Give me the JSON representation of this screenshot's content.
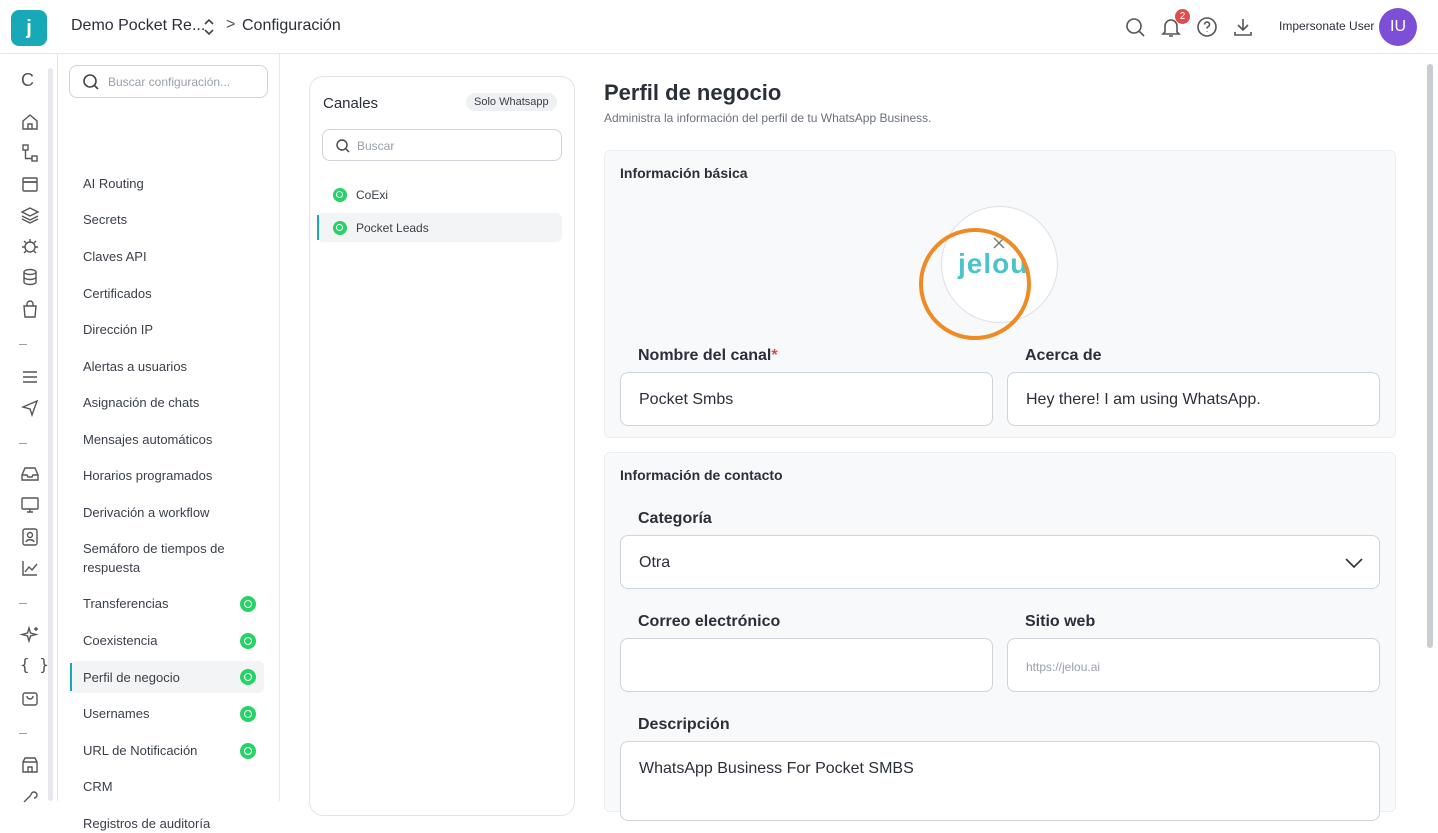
{
  "header": {
    "logo_letter": "j",
    "workspace": "Demo Pocket Re...",
    "breadcrumb_sep": ">",
    "breadcrumb_current": "Configuración",
    "notification_count": "2",
    "user_name": "Impersonate User",
    "user_initials": "IU",
    "icons": [
      "search-icon",
      "bell-icon",
      "help-icon",
      "download-icon"
    ]
  },
  "rail": {
    "first_glyph": "C",
    "icons": [
      "home-icon",
      "flow-icon",
      "archive-icon",
      "layers-icon",
      "bug-icon",
      "database-icon",
      "bag-icon",
      "list-icon",
      "send-icon",
      "inbox-icon",
      "monitor-icon",
      "contact-icon",
      "chart-icon",
      "sparkle-icon",
      "braces-icon",
      "shop-icon",
      "store-icon"
    ]
  },
  "settings_nav": {
    "search_placeholder": "Buscar configuración...",
    "items": [
      {
        "label": "AI Routing",
        "wa": false
      },
      {
        "label": "Secrets",
        "wa": false
      },
      {
        "label": "Claves API",
        "wa": false
      },
      {
        "label": "Certificados",
        "wa": false
      },
      {
        "label": "Dirección IP",
        "wa": false
      },
      {
        "label": "Alertas a usuarios",
        "wa": false
      },
      {
        "label": "Asignación de chats",
        "wa": false
      },
      {
        "label": "Mensajes automáticos",
        "wa": false
      },
      {
        "label": "Horarios programados",
        "wa": false
      },
      {
        "label": "Derivación a workflow",
        "wa": false
      },
      {
        "label": "Semáforo de tiempos de respuesta",
        "wa": false
      },
      {
        "label": "Transferencias",
        "wa": true
      },
      {
        "label": "Coexistencia",
        "wa": true
      },
      {
        "label": "Perfil de negocio",
        "wa": true,
        "active": true
      },
      {
        "label": "Usernames",
        "wa": true
      },
      {
        "label": "URL de Notificación",
        "wa": true
      },
      {
        "label": "CRM",
        "wa": false
      },
      {
        "label": "Registros de auditoría",
        "wa": false
      }
    ]
  },
  "channels": {
    "title": "Canales",
    "filter_badge": "Solo Whatsapp",
    "search_placeholder": "Buscar",
    "items": [
      {
        "label": "CoExi",
        "active": false
      },
      {
        "label": "Pocket Leads",
        "active": true
      }
    ]
  },
  "main": {
    "title": "Perfil de negocio",
    "subtitle": "Administra la información del perfil de tu WhatsApp Business.",
    "basic_info": {
      "title": "Información básica",
      "logo_text": "jelou",
      "channel_name_label": "Nombre del canal",
      "required_mark": "*",
      "channel_name_value": "Pocket Smbs",
      "about_label": "Acerca de",
      "about_value": "Hey there! I am using WhatsApp."
    },
    "contact_info": {
      "title": "Información de contacto",
      "category_label": "Categoría",
      "category_value": "Otra",
      "email_label": "Correo electrónico",
      "email_value": "",
      "website_label": "Sitio web",
      "website_placeholder": "https://jelou.ai",
      "description_label": "Descripción",
      "description_value": "WhatsApp Business For Pocket SMBS"
    }
  },
  "colors": {
    "brand": "#17a9b7",
    "avatar": "#7c4fd6",
    "whatsapp": "#25d366",
    "highlight_ring": "#f08a24",
    "badge": "#e04b4b"
  }
}
